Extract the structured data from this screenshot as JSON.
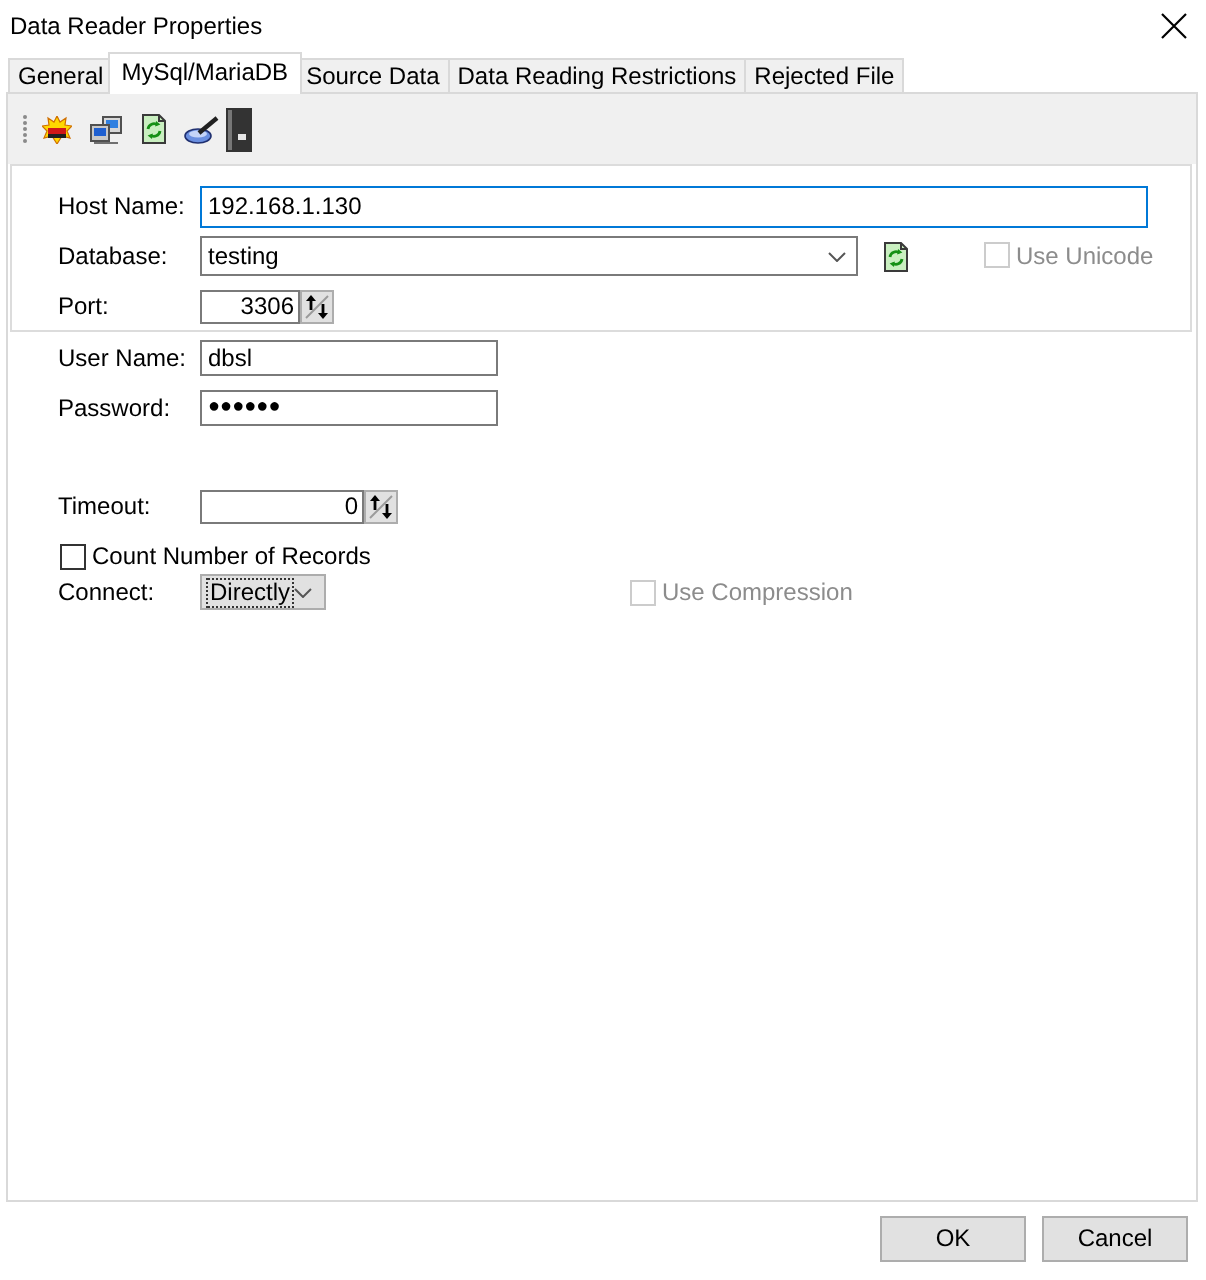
{
  "window": {
    "title": "Data Reader Properties"
  },
  "tabs": [
    {
      "label": "General",
      "selected": false
    },
    {
      "label": "MySql/MariaDB",
      "selected": true
    },
    {
      "label": "Source Data",
      "selected": false
    },
    {
      "label": "Data Reading Restrictions",
      "selected": false
    },
    {
      "label": "Rejected File",
      "selected": false
    }
  ],
  "server_panel": {
    "fields": [
      {
        "kind": "text",
        "label": "Host Name:",
        "value": "192.168.1.130",
        "focused": true
      },
      {
        "kind": "dropdown",
        "label": "Database:",
        "value": "testing",
        "option": {
          "label": "Use Unicode",
          "checked": false,
          "disabled": true
        }
      },
      {
        "kind": "spin",
        "label": "Port:",
        "value": "3306"
      }
    ]
  },
  "login_fields": [
    {
      "kind": "text",
      "label": "User Name:",
      "value": "dbsl"
    },
    {
      "kind": "password",
      "label": "Password:",
      "value": "●●●●●●"
    }
  ],
  "timeout": {
    "kind": "spin",
    "label": "Timeout:",
    "value": "0"
  },
  "count_records": {
    "label": "Count Number of Records",
    "checked": false
  },
  "connect": {
    "kind": "combo",
    "label": "Connect:",
    "value": "Directly",
    "focused": true
  },
  "use_compression": {
    "label": "Use Compression",
    "checked": false,
    "disabled": true
  },
  "buttons": [
    {
      "label": "OK"
    },
    {
      "label": "Cancel"
    }
  ]
}
